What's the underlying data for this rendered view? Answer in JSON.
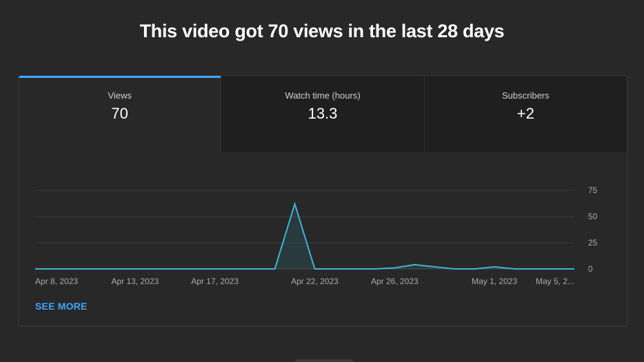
{
  "headline": "This video got 70 views in the last 28 days",
  "tabs": [
    {
      "label": "Views",
      "value": "70",
      "active": true
    },
    {
      "label": "Watch time (hours)",
      "value": "13.3",
      "active": false
    },
    {
      "label": "Subscribers",
      "value": "+2",
      "active": false
    }
  ],
  "see_more": "SEE MORE",
  "colors": {
    "accent": "#3ea6ff",
    "line": "#41b4d9",
    "background": "#282828",
    "tab_inactive": "#1f1f1f"
  },
  "chart_data": {
    "type": "area",
    "title": "",
    "xlabel": "",
    "ylabel": "",
    "x": [
      "Apr 8",
      "Apr 9",
      "Apr 10",
      "Apr 11",
      "Apr 12",
      "Apr 13",
      "Apr 14",
      "Apr 15",
      "Apr 16",
      "Apr 17",
      "Apr 18",
      "Apr 19",
      "Apr 20",
      "Apr 21",
      "Apr 22",
      "Apr 23",
      "Apr 24",
      "Apr 25",
      "Apr 26",
      "Apr 27",
      "Apr 28",
      "Apr 29",
      "Apr 30",
      "May 1",
      "May 2",
      "May 3",
      "May 4",
      "May 5"
    ],
    "series": [
      {
        "name": "",
        "values": [
          0,
          0,
          0,
          0,
          0,
          0,
          0,
          0,
          0,
          0,
          0,
          0,
          0,
          62,
          0,
          0,
          0,
          0,
          1,
          4,
          2,
          0,
          0,
          2,
          0,
          0,
          0,
          0
        ]
      }
    ],
    "x_tick_labels": [
      "Apr 8, 2023",
      "Apr 13, 2023",
      "Apr 17, 2023",
      "Apr 22, 2023",
      "Apr 26, 2023",
      "May 1, 2023",
      "May 5, 2..."
    ],
    "x_tick_indices": [
      0,
      5,
      9,
      14,
      18,
      23,
      27
    ],
    "y_ticks": [
      0,
      25,
      50,
      75
    ],
    "ylim": [
      0,
      75
    ],
    "grid": true,
    "y_axis_position": "right"
  }
}
